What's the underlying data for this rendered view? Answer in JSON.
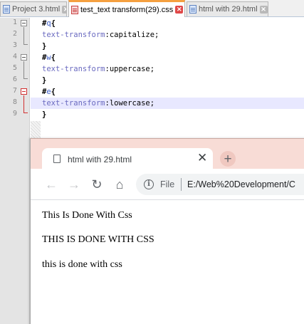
{
  "editor": {
    "tabs": [
      {
        "label": "Project 3.html",
        "active": false,
        "modified": false
      },
      {
        "label": "test_text transform(29).css",
        "active": true,
        "modified": true
      },
      {
        "label": "html with 29.html",
        "active": false,
        "modified": false
      }
    ],
    "line_numbers": [
      "1",
      "2",
      "3",
      "4",
      "5",
      "6",
      "7",
      "8",
      "9"
    ],
    "code": {
      "l1": {
        "hash": "#",
        "id": "q",
        "brace": "{"
      },
      "l2": {
        "prop": "text-transform",
        "colon": ":",
        "value": "capitalize;"
      },
      "l3": {
        "brace": "}"
      },
      "l4": {
        "hash": "#",
        "id": "w",
        "brace": "{"
      },
      "l5": {
        "prop": "text-transform",
        "colon": ":",
        "value": "uppercase;"
      },
      "l6": {
        "brace": "}"
      },
      "l7": {
        "hash": "#",
        "id": "e",
        "brace": "{"
      },
      "l8": {
        "prop": "text-transform",
        "colon": ":",
        "value": "lowercase;"
      },
      "l9": {
        "brace": "}"
      }
    },
    "highlighted_line": "8"
  },
  "browser": {
    "tab_title": "html with 29.html",
    "close_glyph": "✕",
    "new_tab_glyph": "+",
    "back_glyph": "←",
    "forward_glyph": "→",
    "reload_glyph": "↻",
    "home_glyph": "⌂",
    "info_glyph": "i",
    "scheme_label": "File",
    "url": "E:/Web%20Development/C",
    "paragraphs": [
      "This Is Done With Css",
      "THIS IS DONE WITH CSS",
      "this is done with css"
    ]
  },
  "colors": {
    "active_tab_accent": "#f5a040",
    "browser_frame": "#f8dcd6",
    "selector_id": "#3a5cc8",
    "property": "#6a6ac0",
    "current_line": "#e8e8ff"
  }
}
